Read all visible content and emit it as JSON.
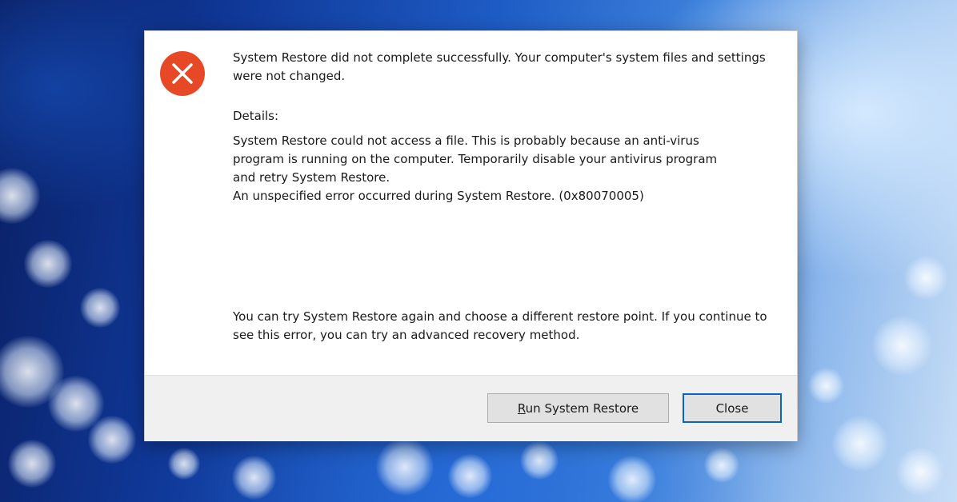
{
  "dialog": {
    "icon": "error-x-icon",
    "main_message": "System Restore did not complete successfully. Your computer's system files and settings were not changed.",
    "details_label": "Details:",
    "details_lines": [
      "System Restore could not access a file. This is probably because an anti-virus",
      "program is running on the computer. Temporarily disable your antivirus program",
      "and retry System Restore.",
      "An unspecified error occurred during System Restore. (0x80070005)"
    ],
    "advice": "You can try System Restore again and choose a different restore point. If you continue to see this error, you can try an advanced recovery method.",
    "buttons": {
      "run_restore_mnemonic": "R",
      "run_restore_rest": "un System Restore",
      "close": "Close"
    }
  },
  "colors": {
    "error_red": "#e74826",
    "focus_border": "#0a64c8",
    "footer_bg": "#f0f0f0"
  }
}
